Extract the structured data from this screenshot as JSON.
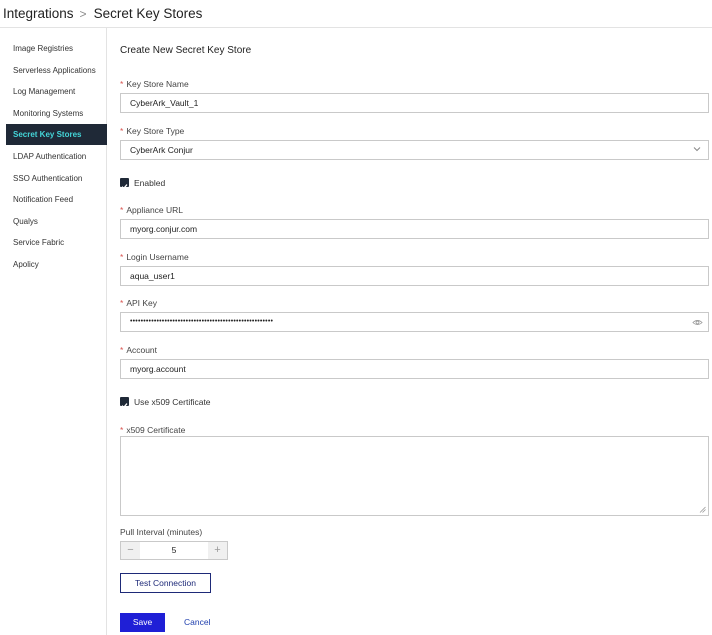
{
  "header": {
    "breadcrumb_root": "Integrations",
    "breadcrumb_sep": ">",
    "breadcrumb_current": "Secret Key Stores"
  },
  "sidebar": {
    "items": [
      {
        "label": "Image Registries"
      },
      {
        "label": "Serverless Applications"
      },
      {
        "label": "Log Management"
      },
      {
        "label": "Monitoring Systems"
      },
      {
        "label": "Secret Key Stores",
        "active": true
      },
      {
        "label": "LDAP Authentication"
      },
      {
        "label": "SSO Authentication"
      },
      {
        "label": "Notification Feed"
      },
      {
        "label": "Qualys"
      },
      {
        "label": "Service Fabric"
      },
      {
        "label": "Apolicy"
      }
    ]
  },
  "form": {
    "title": "Create New Secret Key Store",
    "required_mark": "*",
    "key_store_name": {
      "label": "Key Store Name",
      "value": "CyberArk_Vault_1"
    },
    "key_store_type": {
      "label": "Key Store Type",
      "value": "CyberArk Conjur"
    },
    "enabled": {
      "label": "Enabled",
      "checked": true
    },
    "appliance_url": {
      "label": "Appliance URL",
      "value": "myorg.conjur.com"
    },
    "login_username": {
      "label": "Login Username",
      "value": "aqua_user1"
    },
    "api_key": {
      "label": "API Key",
      "value": "••••••••••••••••••••••••••••••••••••••••••••••••••••••"
    },
    "account": {
      "label": "Account",
      "value": "myorg.account"
    },
    "use_x509": {
      "label": "Use x509 Certificate",
      "checked": true
    },
    "x509_certificate": {
      "label": "x509 Certificate",
      "value": ""
    },
    "pull_interval": {
      "label": "Pull Interval (minutes)",
      "value": "5",
      "decrement": "−",
      "increment": "+"
    },
    "test_connection_label": "Test Connection",
    "save_label": "Save",
    "cancel_label": "Cancel"
  },
  "colors": {
    "accent": "#1f1fd6",
    "sidebar_active_bg": "#1f2937",
    "sidebar_active_text": "#44d6d9",
    "required": "#d9534f"
  }
}
